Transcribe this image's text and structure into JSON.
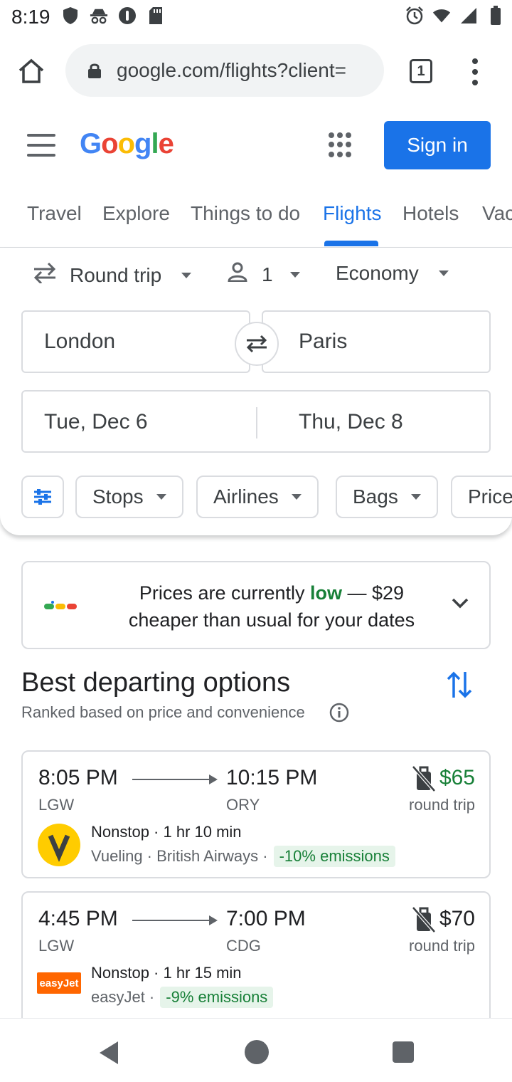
{
  "status_bar": {
    "time": "8:19",
    "icons": [
      "shield-notification-icon",
      "incognito-icon",
      "podcast-icon",
      "sd-card-icon",
      "alarm-icon",
      "wifi-icon",
      "signal-icon",
      "battery-icon"
    ]
  },
  "browser": {
    "url": "google.com/flights?client=",
    "tab_count": "1"
  },
  "header": {
    "logo_text": "Google",
    "signin_label": "Sign in"
  },
  "nav_tabs": [
    {
      "label": "Travel"
    },
    {
      "label": "Explore"
    },
    {
      "label": "Things to do"
    },
    {
      "label": "Flights"
    },
    {
      "label": "Hotels"
    },
    {
      "label": "Vac"
    }
  ],
  "active_tab": "Flights",
  "search": {
    "trip_type": "Round trip",
    "passengers": "1",
    "cabin_class": "Economy",
    "origin": "London",
    "destination": "Paris",
    "depart_date": "Tue, Dec 6",
    "return_date": "Thu, Dec 8"
  },
  "filters": [
    {
      "label": "Stops"
    },
    {
      "label": "Airlines"
    },
    {
      "label": "Bags"
    },
    {
      "label": "Price"
    }
  ],
  "price_insight": {
    "text_before": "Prices are currently ",
    "highlight": "low",
    "text_after": " — $29 cheaper than usual for your dates"
  },
  "best_section": {
    "title": "Best departing options",
    "subtitle": "Ranked based on price and convenience"
  },
  "flights": [
    {
      "depart_time": "8:05 PM",
      "arrive_time": "10:15 PM",
      "depart_code": "LGW",
      "arrive_code": "ORY",
      "price": "$65",
      "price_type": "round trip",
      "stops": "Nonstop · 1 hr 10 min",
      "carriers": "Vueling · British Airways ·",
      "emissions": "-10% emissions"
    },
    {
      "depart_time": "4:45 PM",
      "arrive_time": "7:00 PM",
      "depart_code": "LGW",
      "arrive_code": "CDG",
      "price": "$70",
      "price_type": "round trip",
      "stops": "Nonstop · 1 hr 15 min",
      "carriers": "easyJet ·",
      "emissions": "-9% emissions",
      "logo_text": "easyJet"
    }
  ],
  "colors": {
    "accent": "#1a73e8",
    "green": "#188038",
    "vueling_yellow": "#ffcc00",
    "easyjet_orange": "#ff6600"
  }
}
